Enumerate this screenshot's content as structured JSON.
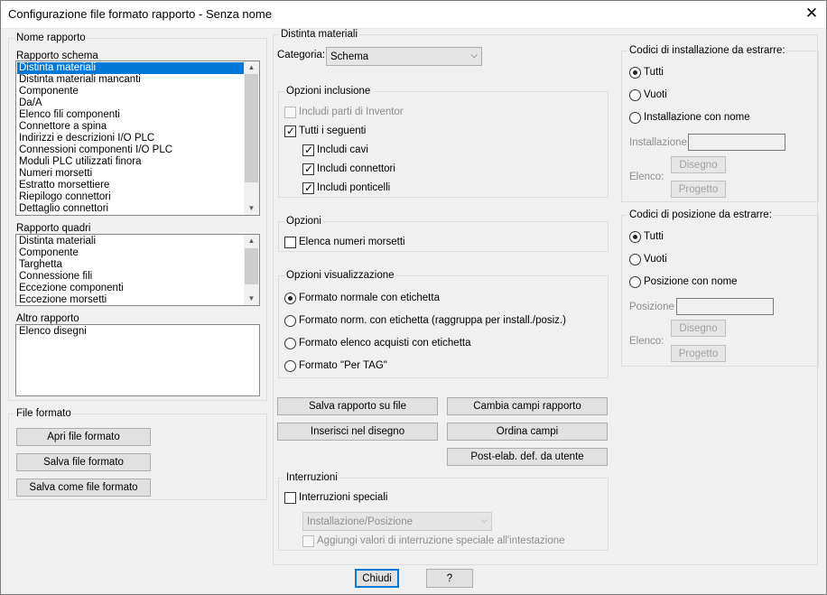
{
  "window": {
    "title": "Configurazione file formato rapporto - Senza nome",
    "close_glyph": "✕"
  },
  "left": {
    "nome_rapporto_legend": "Nome rapporto",
    "rapporto_schema_label": "Rapporto schema",
    "rapporto_schema_items": [
      "Distinta materiali",
      "Distinta materiali mancanti",
      "Componente",
      "Da/A",
      "Elenco fili componenti",
      "Connettore a spina",
      "Indirizzi e descrizioni I/O PLC",
      "Connessioni componenti I/O PLC",
      "Moduli PLC utilizzati finora",
      "Numeri morsetti",
      "Estratto morsettiere",
      "Riepilogo connettori",
      "Dettaglio connettori"
    ],
    "rapporto_quadri_label": "Rapporto quadri",
    "rapporto_quadri_items": [
      "Distinta materiali",
      "Componente",
      "Targhetta",
      "Connessione fili",
      "Eccezione componenti",
      "Eccezione morsetti"
    ],
    "altro_rapporto_label": "Altro rapporto",
    "altro_rapporto_items": [
      "Elenco disegni"
    ],
    "file_formato_legend": "File formato",
    "apri_button": "Apri file formato",
    "salva_button": "Salva file formato",
    "salva_come_button": "Salva come file formato"
  },
  "middle": {
    "distinta_legend": "Distinta materiali",
    "categoria_label": "Categoria:",
    "categoria_value": "Schema",
    "opzioni_inclusione_legend": "Opzioni inclusione",
    "includi_inventor": "Includi parti di Inventor",
    "tutti_seguenti": "Tutti i seguenti",
    "includi_cavi": "Includi cavi",
    "includi_connettori": "Includi connettori",
    "includi_ponticelli": "Includi ponticelli",
    "opzioni_legend": "Opzioni",
    "elenca_numeri": "Elenca numeri morsetti",
    "opzioni_vis_legend": "Opzioni visualizzazione",
    "formato_normale": "Formato normale con etichetta",
    "formato_norm_raggr": "Formato norm. con etichetta (raggruppa per install./posiz.)",
    "formato_acquisti": "Formato elenco acquisti con etichetta",
    "formato_per_tag": "Formato \"Per TAG\"",
    "salva_rapporto_button": "Salva rapporto su file",
    "cambia_campi_button": "Cambia campi rapporto",
    "inserisci_button": "Inserisci nel disegno",
    "ordina_button": "Ordina campi",
    "post_elab_button": "Post-elab. def. da utente",
    "interruzioni_legend": "Interruzioni",
    "interruzioni_speciali": "Interruzioni speciali",
    "interruzioni_combo_value": "Installazione/Posizione",
    "aggiungi_valori": "Aggiungi valori di interruzione speciale all'intestazione"
  },
  "right": {
    "installazione_legend": "Codici di installazione da estrarre:",
    "inst_tutti": "Tutti",
    "inst_vuoti": "Vuoti",
    "inst_con_nome": "Installazione con nome",
    "inst_field_label": "Installazione",
    "inst_elenco_label": "Elenco:",
    "inst_disegno_button": "Disegno",
    "inst_progetto_button": "Progetto",
    "posizione_legend": "Codici di posizione da estrarre:",
    "pos_tutti": "Tutti",
    "pos_vuoti": "Vuoti",
    "pos_con_nome": "Posizione con nome",
    "pos_field_label": "Posizione",
    "pos_elenco_label": "Elenco:",
    "pos_disegno_button": "Disegno",
    "pos_progetto_button": "Progetto"
  },
  "footer": {
    "chiudi_button": "Chiudi",
    "help_button": "?"
  },
  "colors": {
    "selection": "#0078d7",
    "dialog_bg": "#f0f0f0"
  }
}
